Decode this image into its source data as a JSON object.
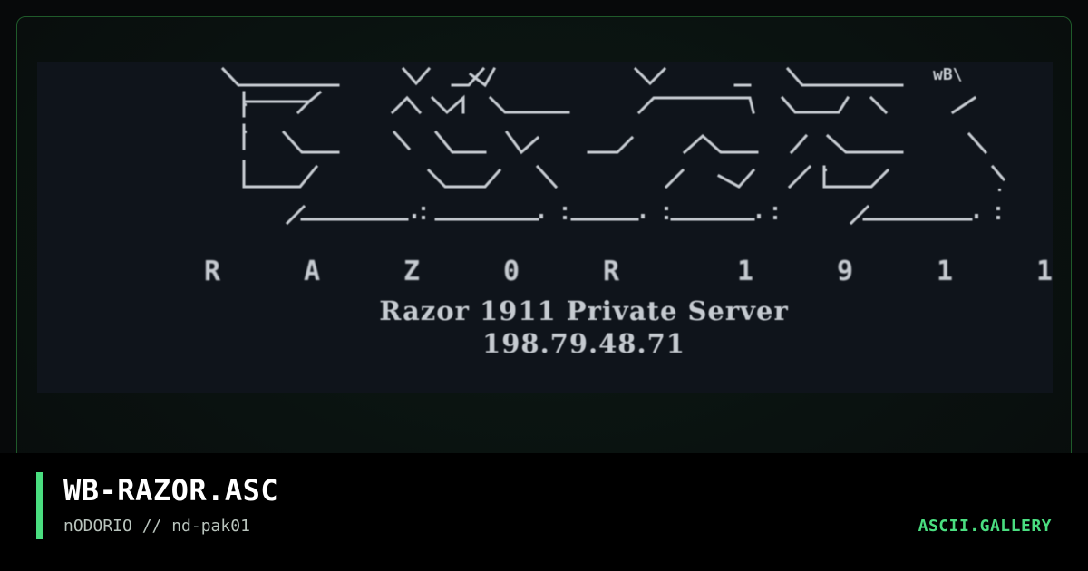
{
  "art": {
    "tag": "wB\\",
    "letters": [
      "R",
      "A",
      "Z",
      "0",
      "R",
      "1",
      "9",
      "1",
      "1"
    ],
    "server_name": "Razor 1911 Private Server",
    "server_ip": "198.79.48.71"
  },
  "footer": {
    "title": "WB-RAZOR.ASC",
    "subtitle": "nODORIO // nd-pak01",
    "brand": "ASCII.GALLERY"
  },
  "colors": {
    "accent": "#4ade80",
    "art_background": "#0f141b",
    "art_text": "#c8cdd3"
  }
}
